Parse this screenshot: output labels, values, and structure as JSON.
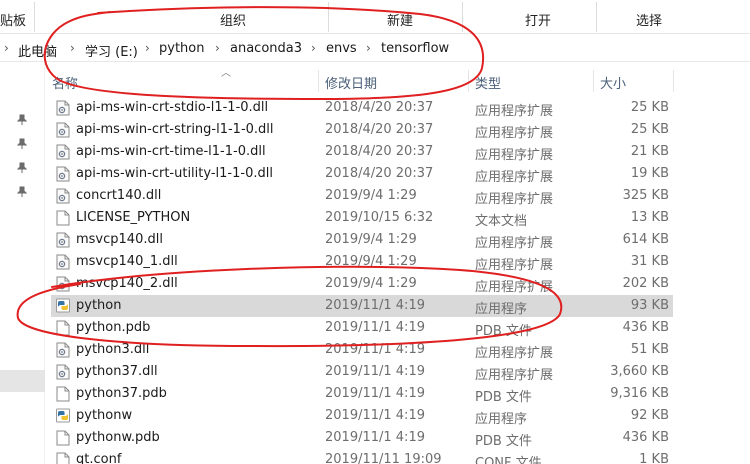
{
  "ribbon": {
    "group_clipboard": "贴板",
    "group_organize": "组织",
    "group_new": "新建",
    "group_open": "打开",
    "group_select": "选择"
  },
  "address": {
    "items": [
      "此电脑",
      "学习 (E:)",
      "python",
      "anaconda3",
      "envs",
      "tensorflow"
    ]
  },
  "columns": {
    "name": "名称",
    "date": "修改日期",
    "type": "类型",
    "size": "大小"
  },
  "files": [
    {
      "name": "api-ms-win-crt-stdio-l1-1-0.dll",
      "date": "2018/4/20 20:37",
      "type": "应用程序扩展",
      "size": "25 KB",
      "icon": "dll-file-icon"
    },
    {
      "name": "api-ms-win-crt-string-l1-1-0.dll",
      "date": "2018/4/20 20:37",
      "type": "应用程序扩展",
      "size": "25 KB",
      "icon": "dll-file-icon"
    },
    {
      "name": "api-ms-win-crt-time-l1-1-0.dll",
      "date": "2018/4/20 20:37",
      "type": "应用程序扩展",
      "size": "21 KB",
      "icon": "dll-file-icon"
    },
    {
      "name": "api-ms-win-crt-utility-l1-1-0.dll",
      "date": "2018/4/20 20:37",
      "type": "应用程序扩展",
      "size": "19 KB",
      "icon": "dll-file-icon"
    },
    {
      "name": "concrt140.dll",
      "date": "2019/9/4 1:29",
      "type": "应用程序扩展",
      "size": "325 KB",
      "icon": "dll-file-icon"
    },
    {
      "name": "LICENSE_PYTHON",
      "date": "2019/10/15 6:32",
      "type": "文本文档",
      "size": "13 KB",
      "icon": "text-file-icon"
    },
    {
      "name": "msvcp140.dll",
      "date": "2019/9/4 1:29",
      "type": "应用程序扩展",
      "size": "614 KB",
      "icon": "dll-file-icon"
    },
    {
      "name": "msvcp140_1.dll",
      "date": "2019/9/4 1:29",
      "type": "应用程序扩展",
      "size": "31 KB",
      "icon": "dll-file-icon"
    },
    {
      "name": "msvcp140_2.dll",
      "date": "2019/9/4 1:29",
      "type": "应用程序扩展",
      "size": "202 KB",
      "icon": "dll-file-icon"
    },
    {
      "name": "python",
      "date": "2019/11/1 4:19",
      "type": "应用程序",
      "size": "93 KB",
      "icon": "python-app-icon",
      "selected": true
    },
    {
      "name": "python.pdb",
      "date": "2019/11/1 4:19",
      "type": "PDB 文件",
      "size": "436 KB",
      "icon": "blank-file-icon"
    },
    {
      "name": "python3.dll",
      "date": "2019/11/1 4:19",
      "type": "应用程序扩展",
      "size": "51 KB",
      "icon": "dll-file-icon"
    },
    {
      "name": "python37.dll",
      "date": "2019/11/1 4:19",
      "type": "应用程序扩展",
      "size": "3,660 KB",
      "icon": "dll-file-icon"
    },
    {
      "name": "python37.pdb",
      "date": "2019/11/1 4:19",
      "type": "PDB 文件",
      "size": "9,316 KB",
      "icon": "blank-file-icon"
    },
    {
      "name": "pythonw",
      "date": "2019/11/1 4:19",
      "type": "应用程序",
      "size": "92 KB",
      "icon": "python-app-icon"
    },
    {
      "name": "pythonw.pdb",
      "date": "2019/11/1 4:19",
      "type": "PDB 文件",
      "size": "436 KB",
      "icon": "blank-file-icon"
    },
    {
      "name": "qt.conf",
      "date": "2019/11/11 19:09",
      "type": "CONF 文件",
      "size": "1 KB",
      "icon": "blank-file-icon"
    }
  ],
  "colors": {
    "header_text": "#4c607a",
    "selected_row": "#d9d9d9",
    "annotation": "#e02020"
  }
}
